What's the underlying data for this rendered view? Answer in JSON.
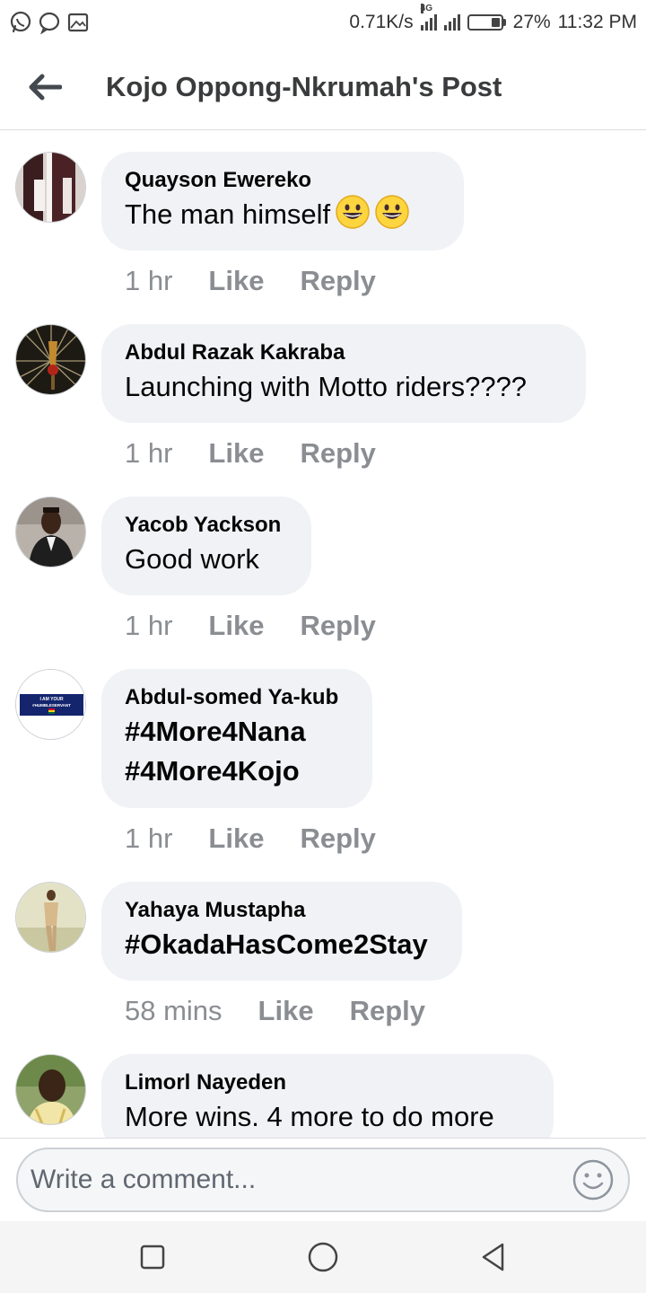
{
  "status_bar": {
    "net_speed": "0.71K/s",
    "network_type": "4G",
    "battery": "27%",
    "battery_level": 0.27,
    "time": "11:32 PM",
    "left_icons": [
      "whatsapp-icon",
      "messenger-icon",
      "gallery-notification-icon"
    ]
  },
  "header": {
    "title": "Kojo Oppong-Nkrumah's Post",
    "back_icon": "arrow-left-icon"
  },
  "comments": [
    {
      "author": "Quayson Ewereko",
      "lines": [
        "The man himself"
      ],
      "emojis": 2,
      "bold_text": false,
      "time": "1 hr",
      "like": "Like",
      "reply": "Reply"
    },
    {
      "author": "Abdul Razak Kakraba",
      "lines": [
        "Launching with Motto riders????"
      ],
      "emojis": 0,
      "bold_text": false,
      "time": "1 hr",
      "like": "Like",
      "reply": "Reply"
    },
    {
      "author": "Yacob Yackson",
      "lines": [
        "Good work"
      ],
      "emojis": 0,
      "bold_text": false,
      "time": "1 hr",
      "like": "Like",
      "reply": "Reply"
    },
    {
      "author": "Abdul-somed Ya-kub",
      "lines": [
        "#4More4Nana",
        "#4More4Kojo"
      ],
      "emojis": 0,
      "bold_text": true,
      "time": "1 hr",
      "like": "Like",
      "reply": "Reply"
    },
    {
      "author": "Yahaya Mustapha",
      "lines": [
        "#OkadaHasCome2Stay"
      ],
      "emojis": 0,
      "bold_text": true,
      "time": "58 mins",
      "like": "Like",
      "reply": "Reply"
    },
    {
      "author": "Limorl Nayeden",
      "lines": [
        "More wins. 4 more to do more"
      ],
      "emojis": 0,
      "bold_text": false,
      "time": "",
      "like": "",
      "reply": ""
    }
  ],
  "avatar_badge_text": [
    "I AM YOUR",
    "#HUMBLESERVANT"
  ],
  "composer": {
    "placeholder": "Write a comment...",
    "emoji_icon": "smiley-icon"
  },
  "navbar": {
    "icons": [
      "recent-apps-icon",
      "home-icon",
      "back-icon"
    ]
  },
  "colors": {
    "bubble": "#f0f2f5",
    "meta_text": "#8a8d91",
    "title": "#3a3b3c"
  }
}
